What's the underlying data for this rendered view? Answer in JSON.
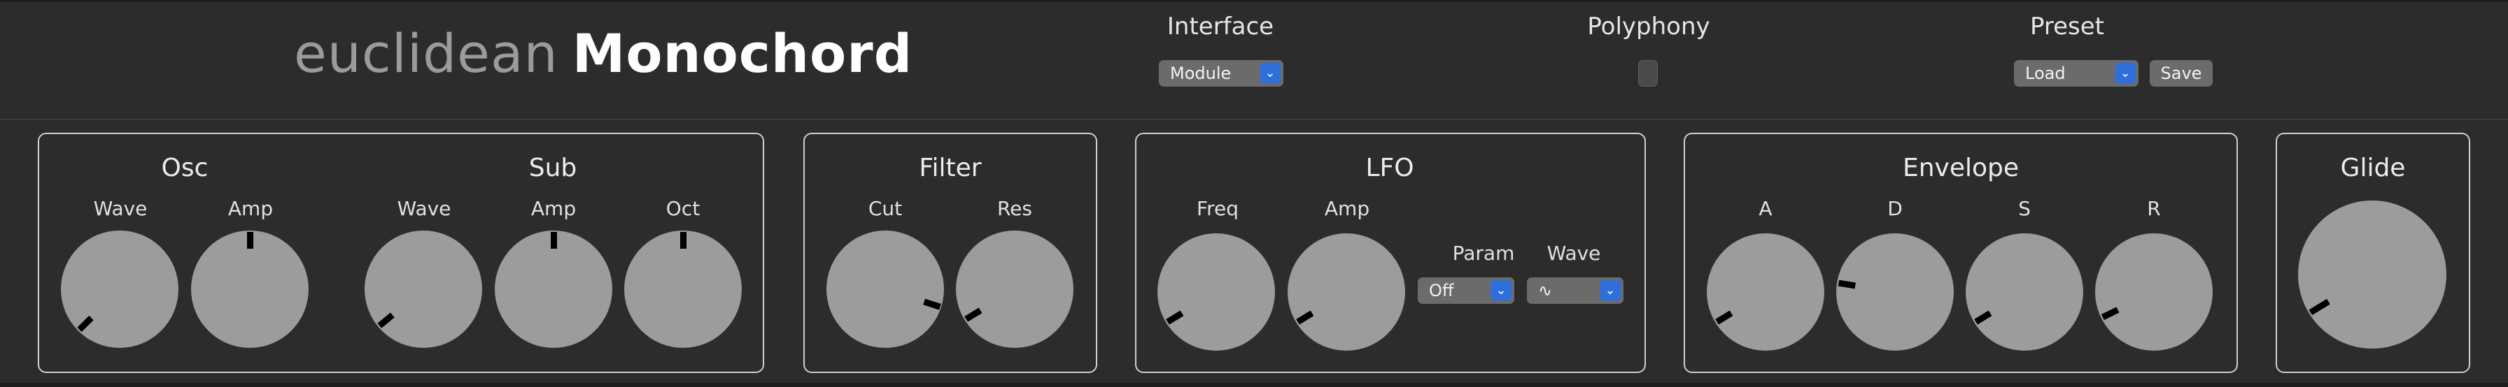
{
  "header": {
    "brand_light": "euclidean",
    "brand_bold": "Monochord",
    "interface": {
      "label": "Interface",
      "value": "Module"
    },
    "polyphony": {
      "label": "Polyphony",
      "checked": false
    },
    "preset": {
      "label": "Preset",
      "value": "Load",
      "save_label": "Save"
    }
  },
  "osc": {
    "title": "Osc",
    "wave_label": "Wave",
    "amp_label": "Amp"
  },
  "sub": {
    "title": "Sub",
    "wave_label": "Wave",
    "amp_label": "Amp",
    "oct_label": "Oct"
  },
  "filter": {
    "title": "Filter",
    "cut_label": "Cut",
    "res_label": "Res"
  },
  "lfo": {
    "title": "LFO",
    "freq_label": "Freq",
    "amp_label": "Amp",
    "param_label": "Param",
    "param_value": "Off",
    "wave_label": "Wave",
    "wave_value": "∿"
  },
  "envelope": {
    "title": "Envelope",
    "a_label": "A",
    "d_label": "D",
    "s_label": "S",
    "r_label": "R"
  },
  "glide": {
    "title": "Glide"
  },
  "knob_levels": {
    "osc_wave": 0.0,
    "osc_amp": 0.5,
    "sub_wave": 0.02,
    "sub_amp": 0.5,
    "sub_oct": 0.5,
    "filter_cut": 0.9,
    "filter_res": 0.05,
    "lfo_freq": 0.05,
    "lfo_amp": 0.05,
    "env_a": 0.05,
    "env_d": 0.2,
    "env_s": 0.05,
    "env_r": 0.07,
    "glide": 0.05
  },
  "colors": {
    "background": "#2c2c2c",
    "knob": "#9c9c9c",
    "accent": "#2f6fd9",
    "border": "#cfcfcf"
  }
}
